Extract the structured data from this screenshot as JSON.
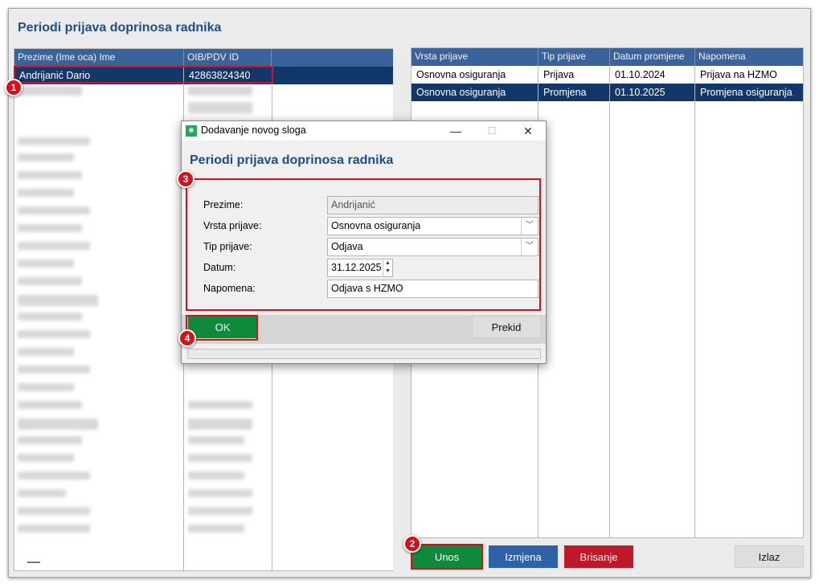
{
  "page_title": "Periodi prijava doprinosa radnika",
  "left_grid": {
    "columns": [
      "Prezime (Ime oca) Ime",
      "OIB/PDV ID"
    ],
    "selected_row": {
      "name": "Andrijanić Dario",
      "oib": "42863824340"
    },
    "partial_visible_text": "04430078432"
  },
  "right_grid": {
    "columns": [
      "Vrsta prijave",
      "Tip prijave",
      "Datum promjene",
      "Napomena"
    ],
    "rows": [
      [
        "Osnovna osiguranja",
        "Prijava",
        "01.10.2024",
        "Prijava na HZMO"
      ],
      [
        "Osnovna osiguranja",
        "Promjena",
        "01.10.2025",
        "Promjena osiguranja"
      ]
    ]
  },
  "buttons": {
    "unos": "Unos",
    "izmjena": "Izmjena",
    "brisanje": "Brisanje",
    "izlaz": "Izlaz"
  },
  "dialog": {
    "window_title": "Dodavanje novog sloga",
    "minimize": "—",
    "maximize": "☐",
    "close": "✕",
    "heading": "Periodi prijava doprinosa radnika",
    "fields": {
      "prezime": {
        "label": "Prezime:",
        "value": "Andrijanić"
      },
      "vrsta_prijave": {
        "label": "Vrsta prijave:",
        "value": "Osnovna osiguranja"
      },
      "tip_prijave": {
        "label": "Tip prijave:",
        "value": "Odjava"
      },
      "datum": {
        "label": "Datum:",
        "value": "31.12.2025"
      },
      "napomena": {
        "label": "Napomena:",
        "value": "Odjava s HZMO"
      }
    },
    "ok_label": "OK",
    "cancel_label": "Prekid"
  },
  "annotations": [
    "1",
    "2",
    "3",
    "4"
  ],
  "colors": {
    "header_blue": "#39639a",
    "selected_row": "#12386b",
    "title_blue": "#1a4f8a",
    "green": "#0f8a3c",
    "blue_button": "#2e62a6",
    "red_button": "#c0182b",
    "callout_red": "#d6111b"
  }
}
